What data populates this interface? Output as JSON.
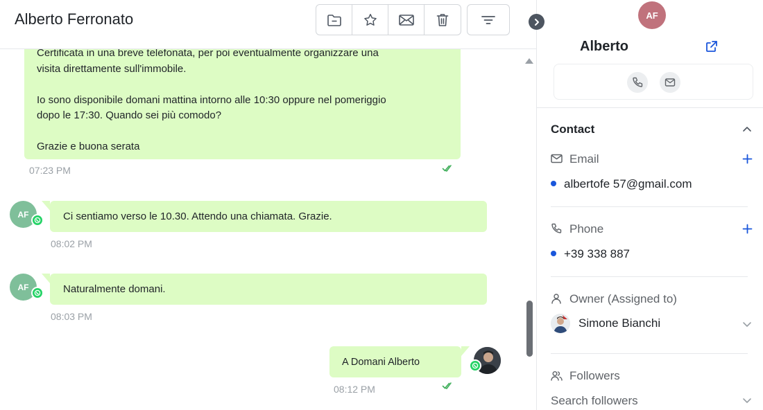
{
  "chat": {
    "contact_name": "Alberto Ferronato",
    "toolbar": {
      "folder_icon": "folder-icon",
      "star_icon": "star-icon",
      "mail_icon": "mail-icon",
      "trash_icon": "trash-icon",
      "filter_icon": "filter-icon"
    },
    "messages": [
      {
        "direction": "outgoing",
        "lines": [
          "Certificata in una breve telefonata, per poi eventualmente organizzare una",
          "visita direttamente sull'immobile.",
          "",
          "Io sono disponibile domani mattina intorno alle 10:30 oppure nel pomeriggio",
          "dopo le 17:30. Quando sei più comodo?",
          "",
          "Grazie e buona serata"
        ],
        "time": "07:23 PM",
        "status": "read"
      },
      {
        "direction": "incoming",
        "avatar_initials": "AF",
        "channel": "whatsapp",
        "text": "Ci sentiamo verso le 10.30. Attendo una chiamata. Grazie.",
        "time": "08:02 PM"
      },
      {
        "direction": "incoming",
        "avatar_initials": "AF",
        "channel": "whatsapp",
        "text": "Naturalmente domani.",
        "time": "08:03 PM"
      },
      {
        "direction": "outgoing",
        "channel": "whatsapp",
        "text": "A Domani Alberto",
        "time": "08:12 PM",
        "status": "read"
      }
    ]
  },
  "sidebar": {
    "avatar_initials": "AF",
    "name": "Alberto",
    "contact_section": {
      "title": "Contact",
      "email_label": "Email",
      "email_value": "albertofe          57@gmail.com",
      "phone_label": "Phone",
      "phone_value": "+39 338 887"
    },
    "owner": {
      "label": "Owner (Assigned to)",
      "name": "Simone Bianchi"
    },
    "followers": {
      "label": "Followers",
      "placeholder": "Search followers"
    }
  },
  "colors": {
    "bubble": "#ddfcc4",
    "incoming_avatar": "#7fbf9a",
    "contact_avatar": "#c0727c",
    "accent_blue": "#1a56db",
    "whatsapp_green": "#25d366"
  }
}
